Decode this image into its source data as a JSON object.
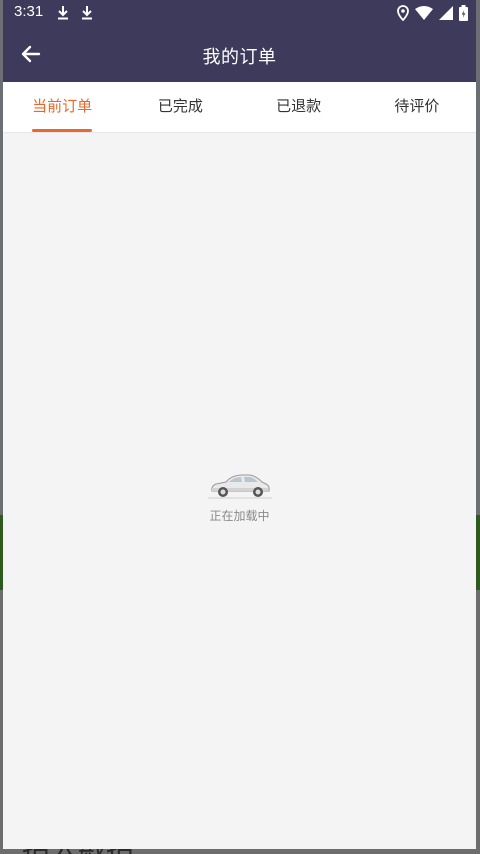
{
  "status_bar": {
    "time": "3:31",
    "left_icons": [
      "download-icon",
      "download-icon"
    ],
    "right_icons": [
      "location-icon",
      "wifi-icon",
      "signal-icon",
      "battery-icon"
    ]
  },
  "header": {
    "title": "我的订单",
    "back_icon": "arrow-left-icon"
  },
  "tabs": [
    {
      "label": "当前订单",
      "active": true
    },
    {
      "label": "已完成",
      "active": false
    },
    {
      "label": "已退款",
      "active": false
    },
    {
      "label": "待评价",
      "active": false
    }
  ],
  "loading": {
    "icon": "car-icon",
    "text": "正在加载中"
  },
  "background_text": "拍入戡拍……",
  "colors": {
    "header_bg": "#3d3a5c",
    "accent": "#e8692b",
    "content_bg": "#f4f4f4"
  }
}
